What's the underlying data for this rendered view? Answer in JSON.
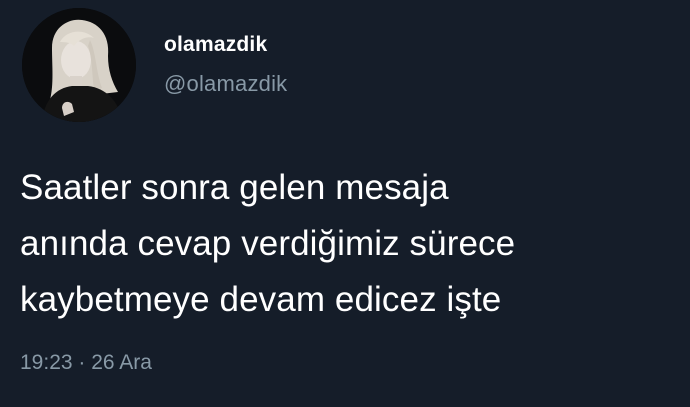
{
  "profile": {
    "display_name": "olamazdik",
    "handle": "@olamazdik",
    "avatar_icon": "profile-photo"
  },
  "tweet": {
    "text": "Saatler sonra gelen mesaja\nanında cevap verdiğimiz sürece\nkaybetmeye devam edicez işte",
    "time": "19:23",
    "separator": " · ",
    "date": "26 Ara"
  },
  "colors": {
    "background": "#151d29",
    "text": "#ffffff",
    "secondary": "#8899a6"
  }
}
